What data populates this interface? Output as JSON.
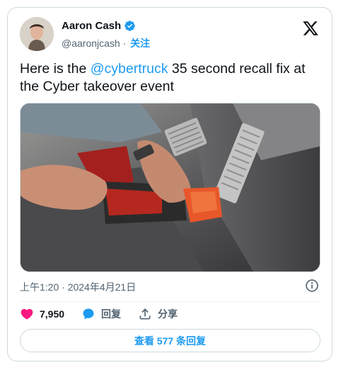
{
  "author": {
    "display_name": "Aaron Cash",
    "handle": "@aaronjcash",
    "separator": " · ",
    "follow_label": "关注"
  },
  "tweet": {
    "text_before": "Here is the ",
    "mention": "@cybertruck",
    "text_after": " 35 second recall fix at the Cyber takeover event",
    "timestamp": "上午1:20 · 2024年4月21日"
  },
  "actions": {
    "like_count": "7,950",
    "reply_label": "回复",
    "share_label": "分享"
  },
  "replies_button_label": "查看 577 条回复",
  "colors": {
    "accent": "#1d9bf0",
    "like": "#f91880",
    "text": "#0f1419",
    "muted": "#536471"
  },
  "icons": [
    "verified-badge-icon",
    "x-logo-icon",
    "info-icon",
    "heart-icon",
    "reply-bubble-icon",
    "share-icon"
  ]
}
